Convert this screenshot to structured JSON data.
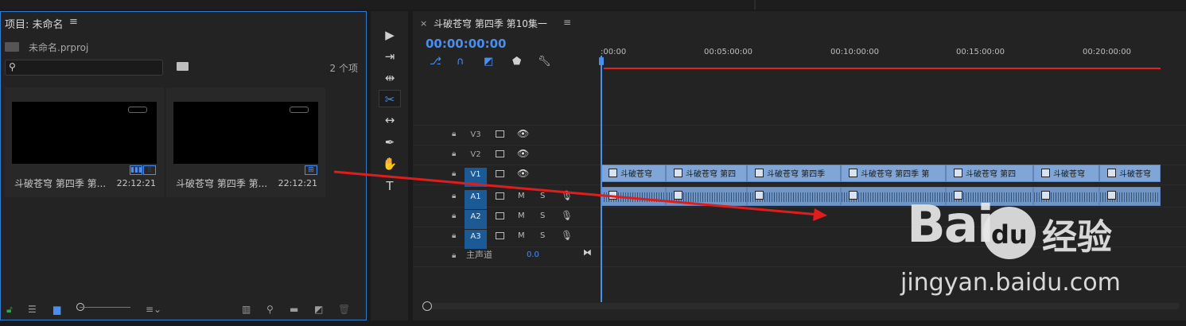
{
  "project_panel": {
    "title": "项目: 未命名",
    "menu_icon": "≡",
    "file_name": "未命名.prproj",
    "item_count": "2 个项",
    "items": [
      {
        "name": "斗破苍穹 第四季 第...",
        "duration": "22:12:21"
      },
      {
        "name": "斗破苍穹 第四季 第...",
        "duration": "22:12:21"
      }
    ]
  },
  "tools": [
    "selection-tool",
    "track-select-tool",
    "ripple-edit-tool",
    "razor-tool",
    "slip-tool",
    "pen-tool",
    "hand-tool",
    "type-tool"
  ],
  "timeline": {
    "sequence_title": "斗破苍穹 第四季 第10集一",
    "close_label": "×",
    "menu_icon": "≡",
    "timecode": "00:00:00:00",
    "ruler": [
      ":00:00",
      "00:05:00:00",
      "00:10:00:00",
      "00:15:00:00",
      "00:20:00:00"
    ],
    "tracks": {
      "v3": "V3",
      "v2": "V2",
      "v1": "V1",
      "a1": "A1",
      "a2": "A2",
      "a3": "A3",
      "mute": "M",
      "solo": "S",
      "master": "主声道",
      "master_value": "0.0"
    },
    "clip_label": "斗破苍穹",
    "video_clips": [
      "斗破苍穹",
      "斗破苍穹 第四",
      "斗破苍穹 第四季",
      "斗破苍穹 第四季 第",
      "斗破苍穹 第四",
      "斗破苍穹",
      "斗破苍穹"
    ]
  },
  "watermark": {
    "brand": "Bai",
    "brand2": "du",
    "cn": "经验",
    "url": "jingyan.baidu.com"
  },
  "colors": {
    "accent": "#4a8ef0",
    "track_active": "#1c5a96",
    "clip": "#7fa6d6",
    "workbar": "#e42020"
  }
}
